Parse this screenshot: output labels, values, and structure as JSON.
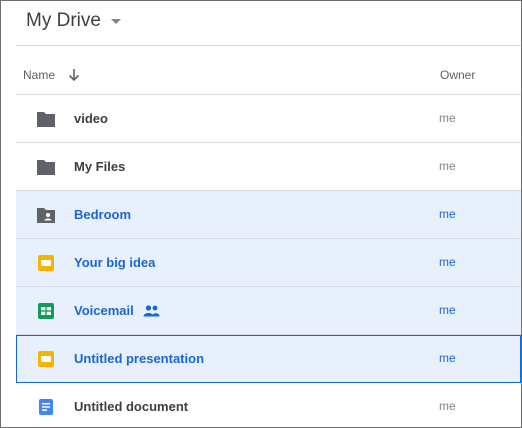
{
  "header": {
    "title": "My Drive"
  },
  "columns": {
    "name": "Name",
    "owner": "Owner"
  },
  "files": [
    {
      "name": "video",
      "owner": "me",
      "icon": "folder-icon",
      "state": "normal"
    },
    {
      "name": "My Files",
      "owner": "me",
      "icon": "folder-icon",
      "state": "normal"
    },
    {
      "name": "Bedroom",
      "owner": "me",
      "icon": "shared-folder-icon",
      "state": "selected"
    },
    {
      "name": "Your big idea",
      "owner": "me",
      "icon": "slides-icon",
      "state": "selected"
    },
    {
      "name": "Voicemail",
      "owner": "me",
      "icon": "sheets-icon",
      "state": "selected",
      "shared": true
    },
    {
      "name": "Untitled presentation",
      "owner": "me",
      "icon": "slides-icon",
      "state": "focused"
    },
    {
      "name": "Untitled document",
      "owner": "me",
      "icon": "docs-icon",
      "state": "normal"
    }
  ],
  "colors": {
    "selection_bg": "#e8f0fe",
    "selection_text": "#1967d2",
    "folder": "#5f6368",
    "slides": "#f4b400",
    "sheets": "#0f9d58",
    "docs": "#4285f4"
  }
}
